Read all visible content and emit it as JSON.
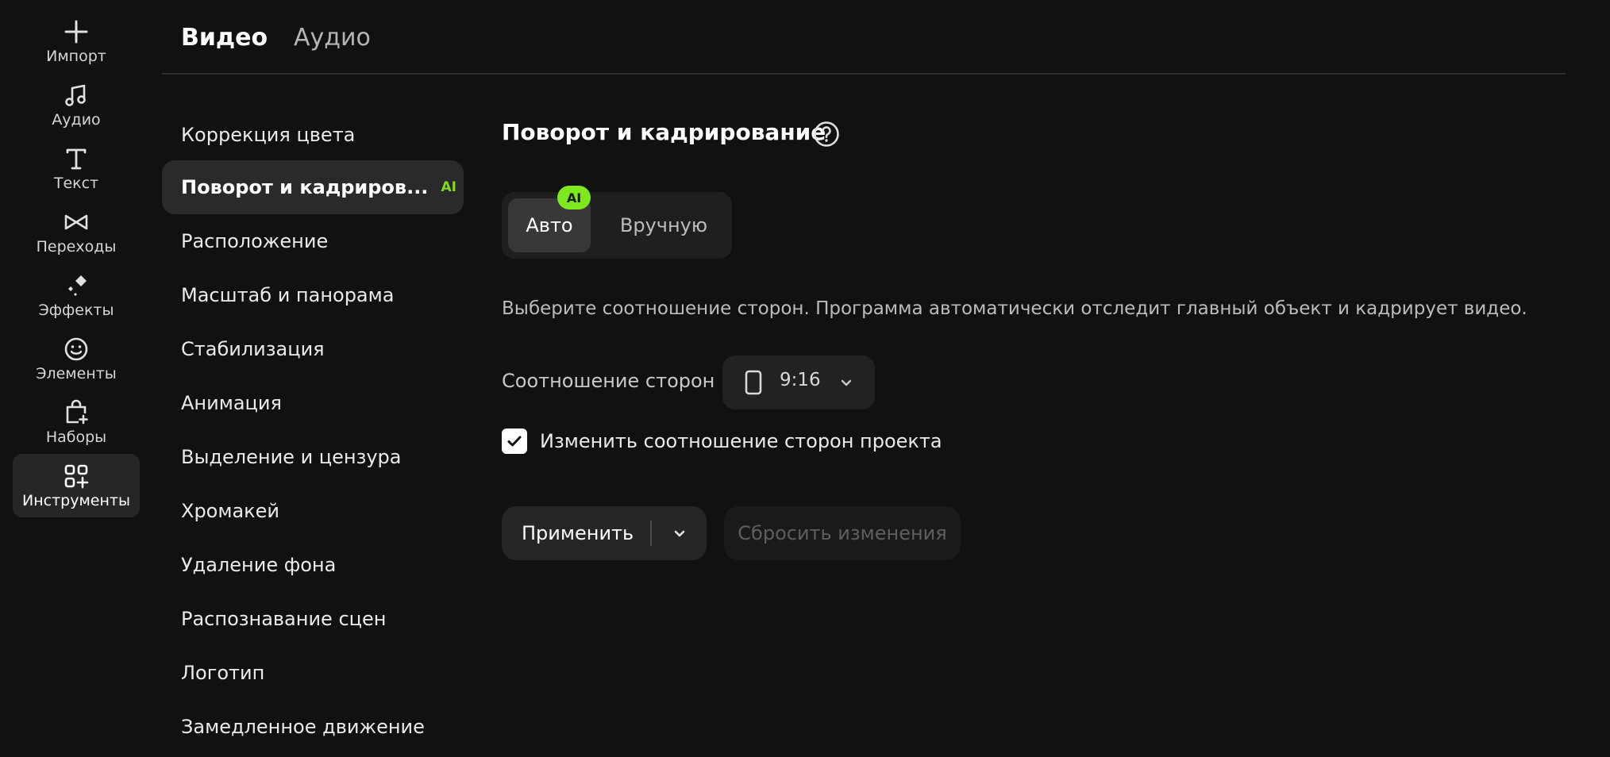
{
  "rail": {
    "items": [
      {
        "label": "Импорт",
        "icon": "plus-icon"
      },
      {
        "label": "Аудио",
        "icon": "music-note-icon"
      },
      {
        "label": "Текст",
        "icon": "text-icon"
      },
      {
        "label": "Переходы",
        "icon": "transition-icon"
      },
      {
        "label": "Эффекты",
        "icon": "sparkle-icon"
      },
      {
        "label": "Элементы",
        "icon": "smiley-icon"
      },
      {
        "label": "Наборы",
        "icon": "bag-plus-icon"
      },
      {
        "label": "Инструменты",
        "icon": "tools-grid-icon",
        "active": true
      }
    ]
  },
  "tabs": [
    {
      "label": "Видео",
      "active": true
    },
    {
      "label": "Аудио",
      "active": false
    }
  ],
  "menu": {
    "items": [
      {
        "label": "Коррекция цвета"
      },
      {
        "label": "Поворот и кадриров...",
        "badge": "AI",
        "active": true
      },
      {
        "label": "Расположение"
      },
      {
        "label": "Масштаб и панорама"
      },
      {
        "label": "Стабилизация"
      },
      {
        "label": "Анимация"
      },
      {
        "label": "Выделение и цензура"
      },
      {
        "label": "Хромакей"
      },
      {
        "label": "Удаление фона"
      },
      {
        "label": "Распознавание сцен"
      },
      {
        "label": "Логотип"
      },
      {
        "label": "Замедленное движение"
      }
    ]
  },
  "panel": {
    "title": "Поворот и кадрирование",
    "mode": {
      "auto_label": "Авто",
      "manual_label": "Вручную",
      "badge": "AI",
      "selected": "Авто"
    },
    "description": "Выберите соотношение сторон. Программа автоматически отследит главный объект и кадрирует видео.",
    "aspect": {
      "label": "Соотношение сторон",
      "value": "9:16"
    },
    "checkbox": {
      "label": "Изменить соотношение сторон проекта",
      "checked": true
    },
    "apply_label": "Применить",
    "reset_label": "Сбросить изменения"
  },
  "colors": {
    "background": "#111111",
    "accent_green": "#7ee81e",
    "active_bg": "#2a2a2a"
  }
}
